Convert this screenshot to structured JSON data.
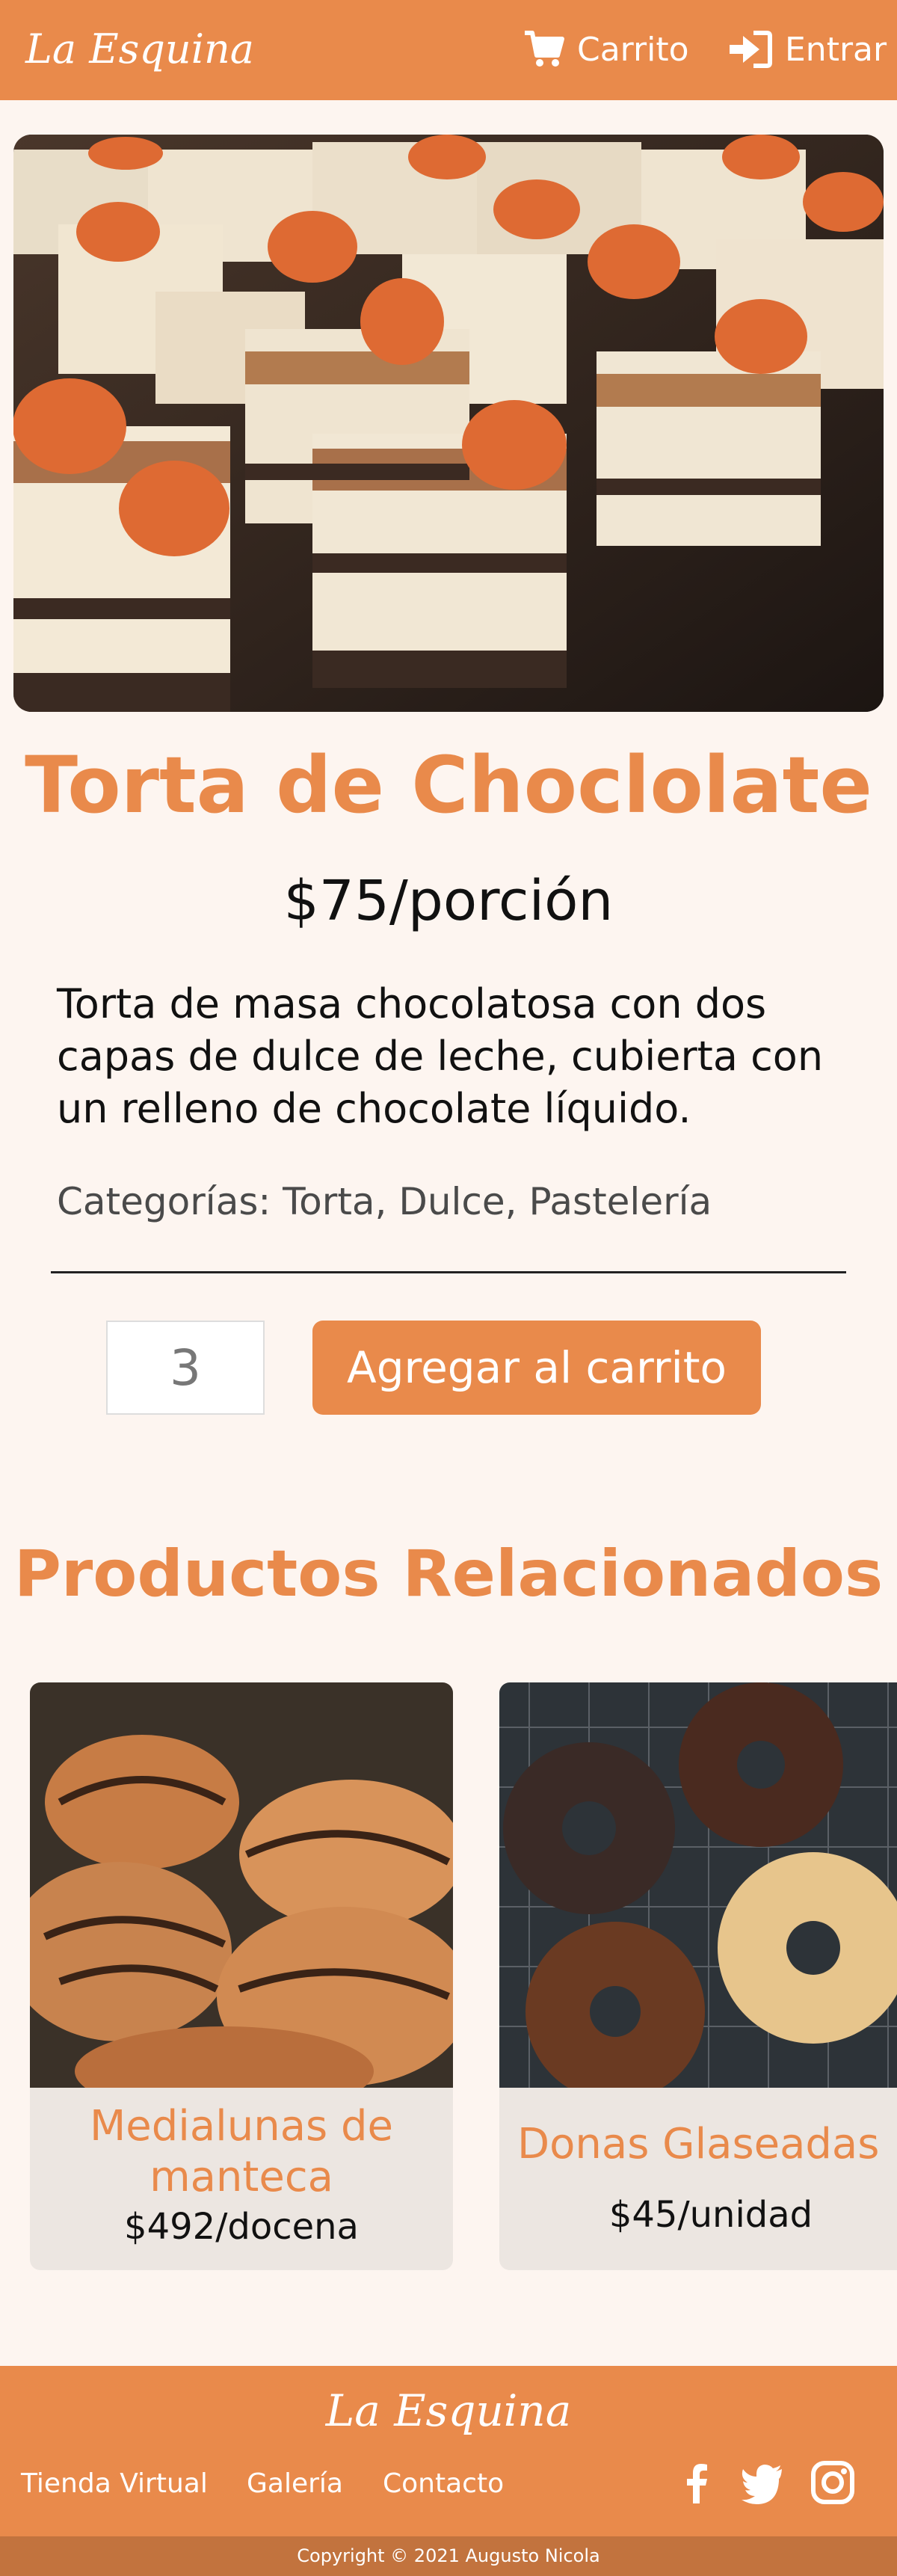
{
  "header": {
    "logo": "La Esquina",
    "cart_label": "Carrito",
    "login_label": "Entrar"
  },
  "product": {
    "image_icon": "tiramisu-cake-photo",
    "title": "Torta de Choclolate",
    "price": "$75/porción",
    "description": "Torta de masa chocolatosa con dos capas de dulce de leche, cubierta con un relleno de chocolate líquido.",
    "categories": "Categorías: Torta, Dulce, Pastelería",
    "quantity": "3",
    "add_to_cart_label": "Agregar al carrito"
  },
  "related": {
    "title": "Productos Relacionados",
    "items": [
      {
        "name": "Medialunas de manteca",
        "price": "$492/docena",
        "image_icon": "croissants-photo"
      },
      {
        "name": "Donas Glaseadas",
        "price": "$45/unidad",
        "image_icon": "donuts-photo"
      }
    ]
  },
  "footer": {
    "logo": "La Esquina",
    "links": [
      "Tienda Virtual",
      "Galería",
      "Contacto"
    ],
    "social_icons": [
      "facebook-icon",
      "twitter-icon",
      "instagram-icon"
    ],
    "copyright": "Copyright © 2021 Augusto Nicola"
  },
  "colors": {
    "brand": "#e98a4b",
    "background": "#fdf5f0",
    "card": "#ece6e1",
    "copyright_bar": "#c2733e"
  }
}
